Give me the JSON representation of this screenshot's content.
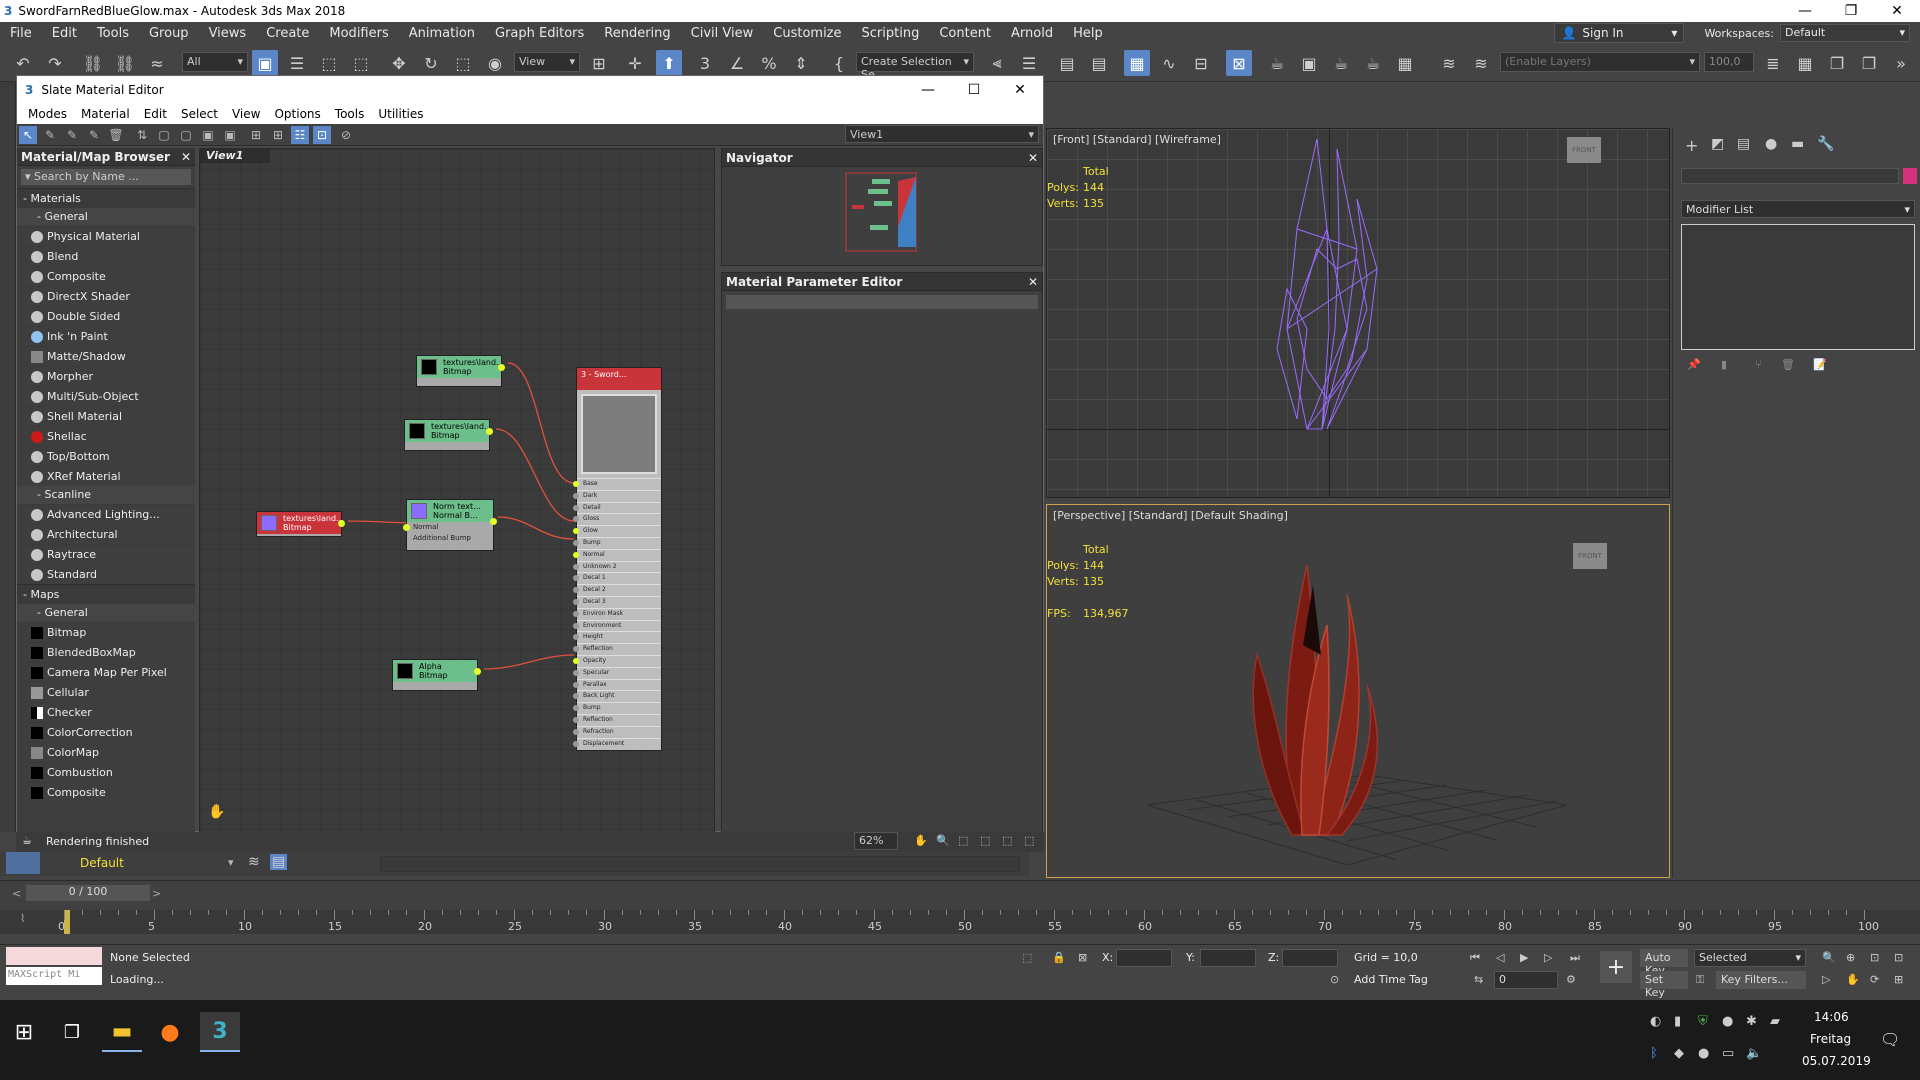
{
  "window": {
    "title": "SwordFarnRedBlueGlow.max - Autodesk 3ds Max 2018",
    "controls": [
      "—",
      "❐",
      "✕"
    ]
  },
  "menu": [
    "File",
    "Edit",
    "Tools",
    "Group",
    "Views",
    "Create",
    "Modifiers",
    "Animation",
    "Graph Editors",
    "Rendering",
    "Civil View",
    "Customize",
    "Scripting",
    "Content",
    "Arnold",
    "Help"
  ],
  "account": {
    "sign_in": "Sign In",
    "workspaces_label": "Workspaces:",
    "workspace_value": "Default"
  },
  "toolbar": {
    "filter_value": "All",
    "view_value": "View",
    "selection_set": "Create Selection Se",
    "layers_placeholder": "(Enable Layers)",
    "percent_value": "100,0"
  },
  "slate": {
    "title": "Slate Material Editor",
    "menu": [
      "Modes",
      "Material",
      "Edit",
      "Select",
      "View",
      "Options",
      "Tools",
      "Utilities"
    ],
    "view_dropdown": "View1",
    "view_tab": "View1",
    "zoom": "62%"
  },
  "browser": {
    "title": "Material/Map Browser",
    "search_placeholder": "Search by Name ...",
    "materials_label": "Materials",
    "general_label": "General",
    "materials_general": [
      "Physical Material",
      "Blend",
      "Composite",
      "DirectX Shader",
      "Double Sided",
      "Ink 'n Paint",
      "Matte/Shadow",
      "Morpher",
      "Multi/Sub-Object",
      "Shell Material",
      "Shellac",
      "Top/Bottom",
      "XRef Material"
    ],
    "scanline_label": "Scanline",
    "scanline": [
      "Advanced Lighting...",
      "Architectural",
      "Raytrace",
      "Standard"
    ],
    "maps_label": "Maps",
    "maps_general_label": "General",
    "maps_general": [
      "Bitmap",
      "BlendedBoxMap",
      "Camera Map Per Pixel",
      "Cellular",
      "Checker",
      "ColorCorrection",
      "ColorMap",
      "Combustion",
      "Composite"
    ]
  },
  "nodes": {
    "bmp1": "textures\\land...",
    "bmp_type": "Bitmap",
    "bmp2": "textures\\land...",
    "bmp3": "textures\\land...",
    "norm_title": "Norm text...",
    "norm_sub": "Normal B...",
    "norm_in1": "Normal",
    "norm_in2": "Additional Bump",
    "alpha": "Alpha",
    "main_title": "3 - Sword...",
    "main_slots": [
      "Base",
      "Dark",
      "Detail",
      "Gloss",
      "Glow",
      "Bump",
      "Normal",
      "Unknown 2",
      "Decal 1",
      "Decal 2",
      "Decal 3",
      "Environ Mask",
      "Environment",
      "Height",
      "Reflection",
      "Opacity",
      "Specular",
      "Parallax",
      "Back Light",
      "Bump",
      "Reflection",
      "Refraction",
      "Displacement"
    ]
  },
  "navigator": {
    "title": "Navigator"
  },
  "mpe": {
    "title": "Material Parameter Editor"
  },
  "viewport_front": {
    "label": "[Front] [Standard] [Wireframe]",
    "total": "Total",
    "polys_label": "Polys:",
    "polys": "144",
    "verts_label": "Verts:",
    "verts": "135",
    "cube": "FRONT"
  },
  "viewport_persp": {
    "label": "[Perspective] [Standard] [Default Shading]",
    "total": "Total",
    "polys_label": "Polys:",
    "polys": "144",
    "verts_label": "Verts:",
    "verts": "135",
    "fps_label": "FPS:",
    "fps": "134,967",
    "cube": "FRONT"
  },
  "cmdpanel": {
    "modifier_list": "Modifier List"
  },
  "status": {
    "rendering": "Rendering finished",
    "layer": "Default",
    "frame": "0 / 100",
    "none_selected": "None Selected",
    "loading": "Loading...",
    "maxscript": "MAXScript Mi",
    "x_label": "X:",
    "y_label": "Y:",
    "z_label": "Z:",
    "grid": "Grid = 10,0",
    "add_time_tag": "Add Time Tag",
    "auto_key": "Auto Key",
    "selected": "Selected",
    "set_key": "Set Key",
    "key_filters": "Key Filters...",
    "frame_field": "0"
  },
  "timeline": {
    "ticks": [
      "0",
      "5",
      "10",
      "15",
      "20",
      "25",
      "30",
      "35",
      "40",
      "45",
      "50",
      "55",
      "60",
      "65",
      "70",
      "75",
      "80",
      "85",
      "90",
      "95",
      "100"
    ]
  },
  "taskbar": {
    "time": "14:06",
    "day": "Freitag",
    "date": "05.07.2019"
  },
  "colors": {
    "accent": "#5b87c9",
    "node_green": "#6cbf8b",
    "wire": "#e2513f",
    "wireframe": "#9b6bff",
    "port": "#e4ff2a"
  }
}
